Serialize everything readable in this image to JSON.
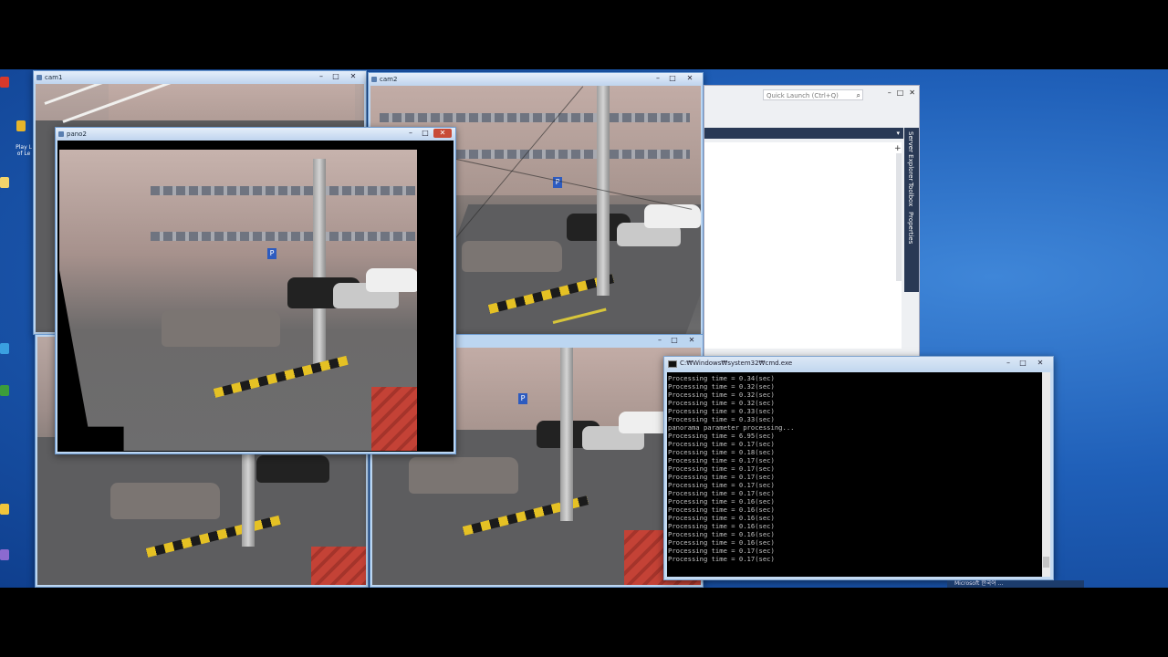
{
  "windows": {
    "cam1": {
      "title": "cam1"
    },
    "cam2": {
      "title": "cam2"
    },
    "pano2": {
      "title": "pano2"
    },
    "cmd": {
      "title": "C:₩Windows₩system32₩cmd.exe",
      "lines": [
        "Processing time = 0.34(sec)",
        "Processing time = 0.32(sec)",
        "Processing time = 0.32(sec)",
        "Processing time = 0.32(sec)",
        "Processing time = 0.33(sec)",
        "Processing time = 0.33(sec)",
        "panorama parameter processing...",
        "Processing time = 6.95(sec)",
        "Processing time = 0.17(sec)",
        "Processing time = 0.18(sec)",
        "Processing time = 0.17(sec)",
        "Processing time = 0.17(sec)",
        "Processing time = 0.17(sec)",
        "Processing time = 0.17(sec)",
        "Processing time = 0.17(sec)",
        "Processing time = 0.16(sec)",
        "Processing time = 0.16(sec)",
        "Processing time = 0.16(sec)",
        "Processing time = 0.16(sec)",
        "Processing time = 0.16(sec)",
        "Processing time = 0.16(sec)",
        "Processing time = 0.17(sec)",
        "Processing time = 0.17(sec)"
      ]
    },
    "vs": {
      "quick_launch": "Quick Launch (Ctrl+Q)",
      "side_tabs": [
        "Server Explorer",
        "Toolbox",
        "Properties"
      ]
    }
  },
  "controls": {
    "minimize": "–",
    "maximize": "□",
    "close": "✕"
  },
  "desktop_icons": {
    "playlist_label": "Play L of Le"
  },
  "taskbar": {
    "notification": "Microsoft 한국어 ..."
  },
  "colors": {
    "desktop": "#1f5fb8",
    "title_active": "#bfd4ee",
    "close": "#c84b37",
    "vs_nav": "#293955"
  }
}
